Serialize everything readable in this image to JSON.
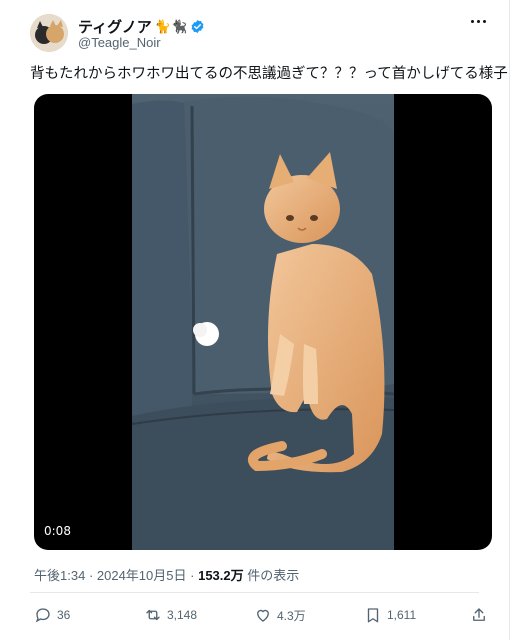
{
  "user": {
    "display_name": "ティグノア",
    "emoji": "🐈🐈‍⬛",
    "handle": "@Teagle_Noir"
  },
  "tweet": {
    "text": "背もたれからホワホワ出てるの不思議過ぎて？？？って首かしげてる様子"
  },
  "media": {
    "video_time": "0:08"
  },
  "meta": {
    "time": "午後1:34",
    "date": "2024年10月5日",
    "views_count": "153.2万",
    "views_label": "件の表示"
  },
  "actions": {
    "replies": "36",
    "reposts": "3,148",
    "likes": "4.3万",
    "bookmarks": "1,611"
  },
  "icons": {
    "verified": "verified-badge-icon",
    "more": "more-icon",
    "reply": "reply-icon",
    "repost": "repost-icon",
    "like": "heart-icon",
    "bookmark": "bookmark-icon",
    "share": "share-icon"
  },
  "colors": {
    "verified": "#1d9bf0",
    "muted": "#536471"
  }
}
